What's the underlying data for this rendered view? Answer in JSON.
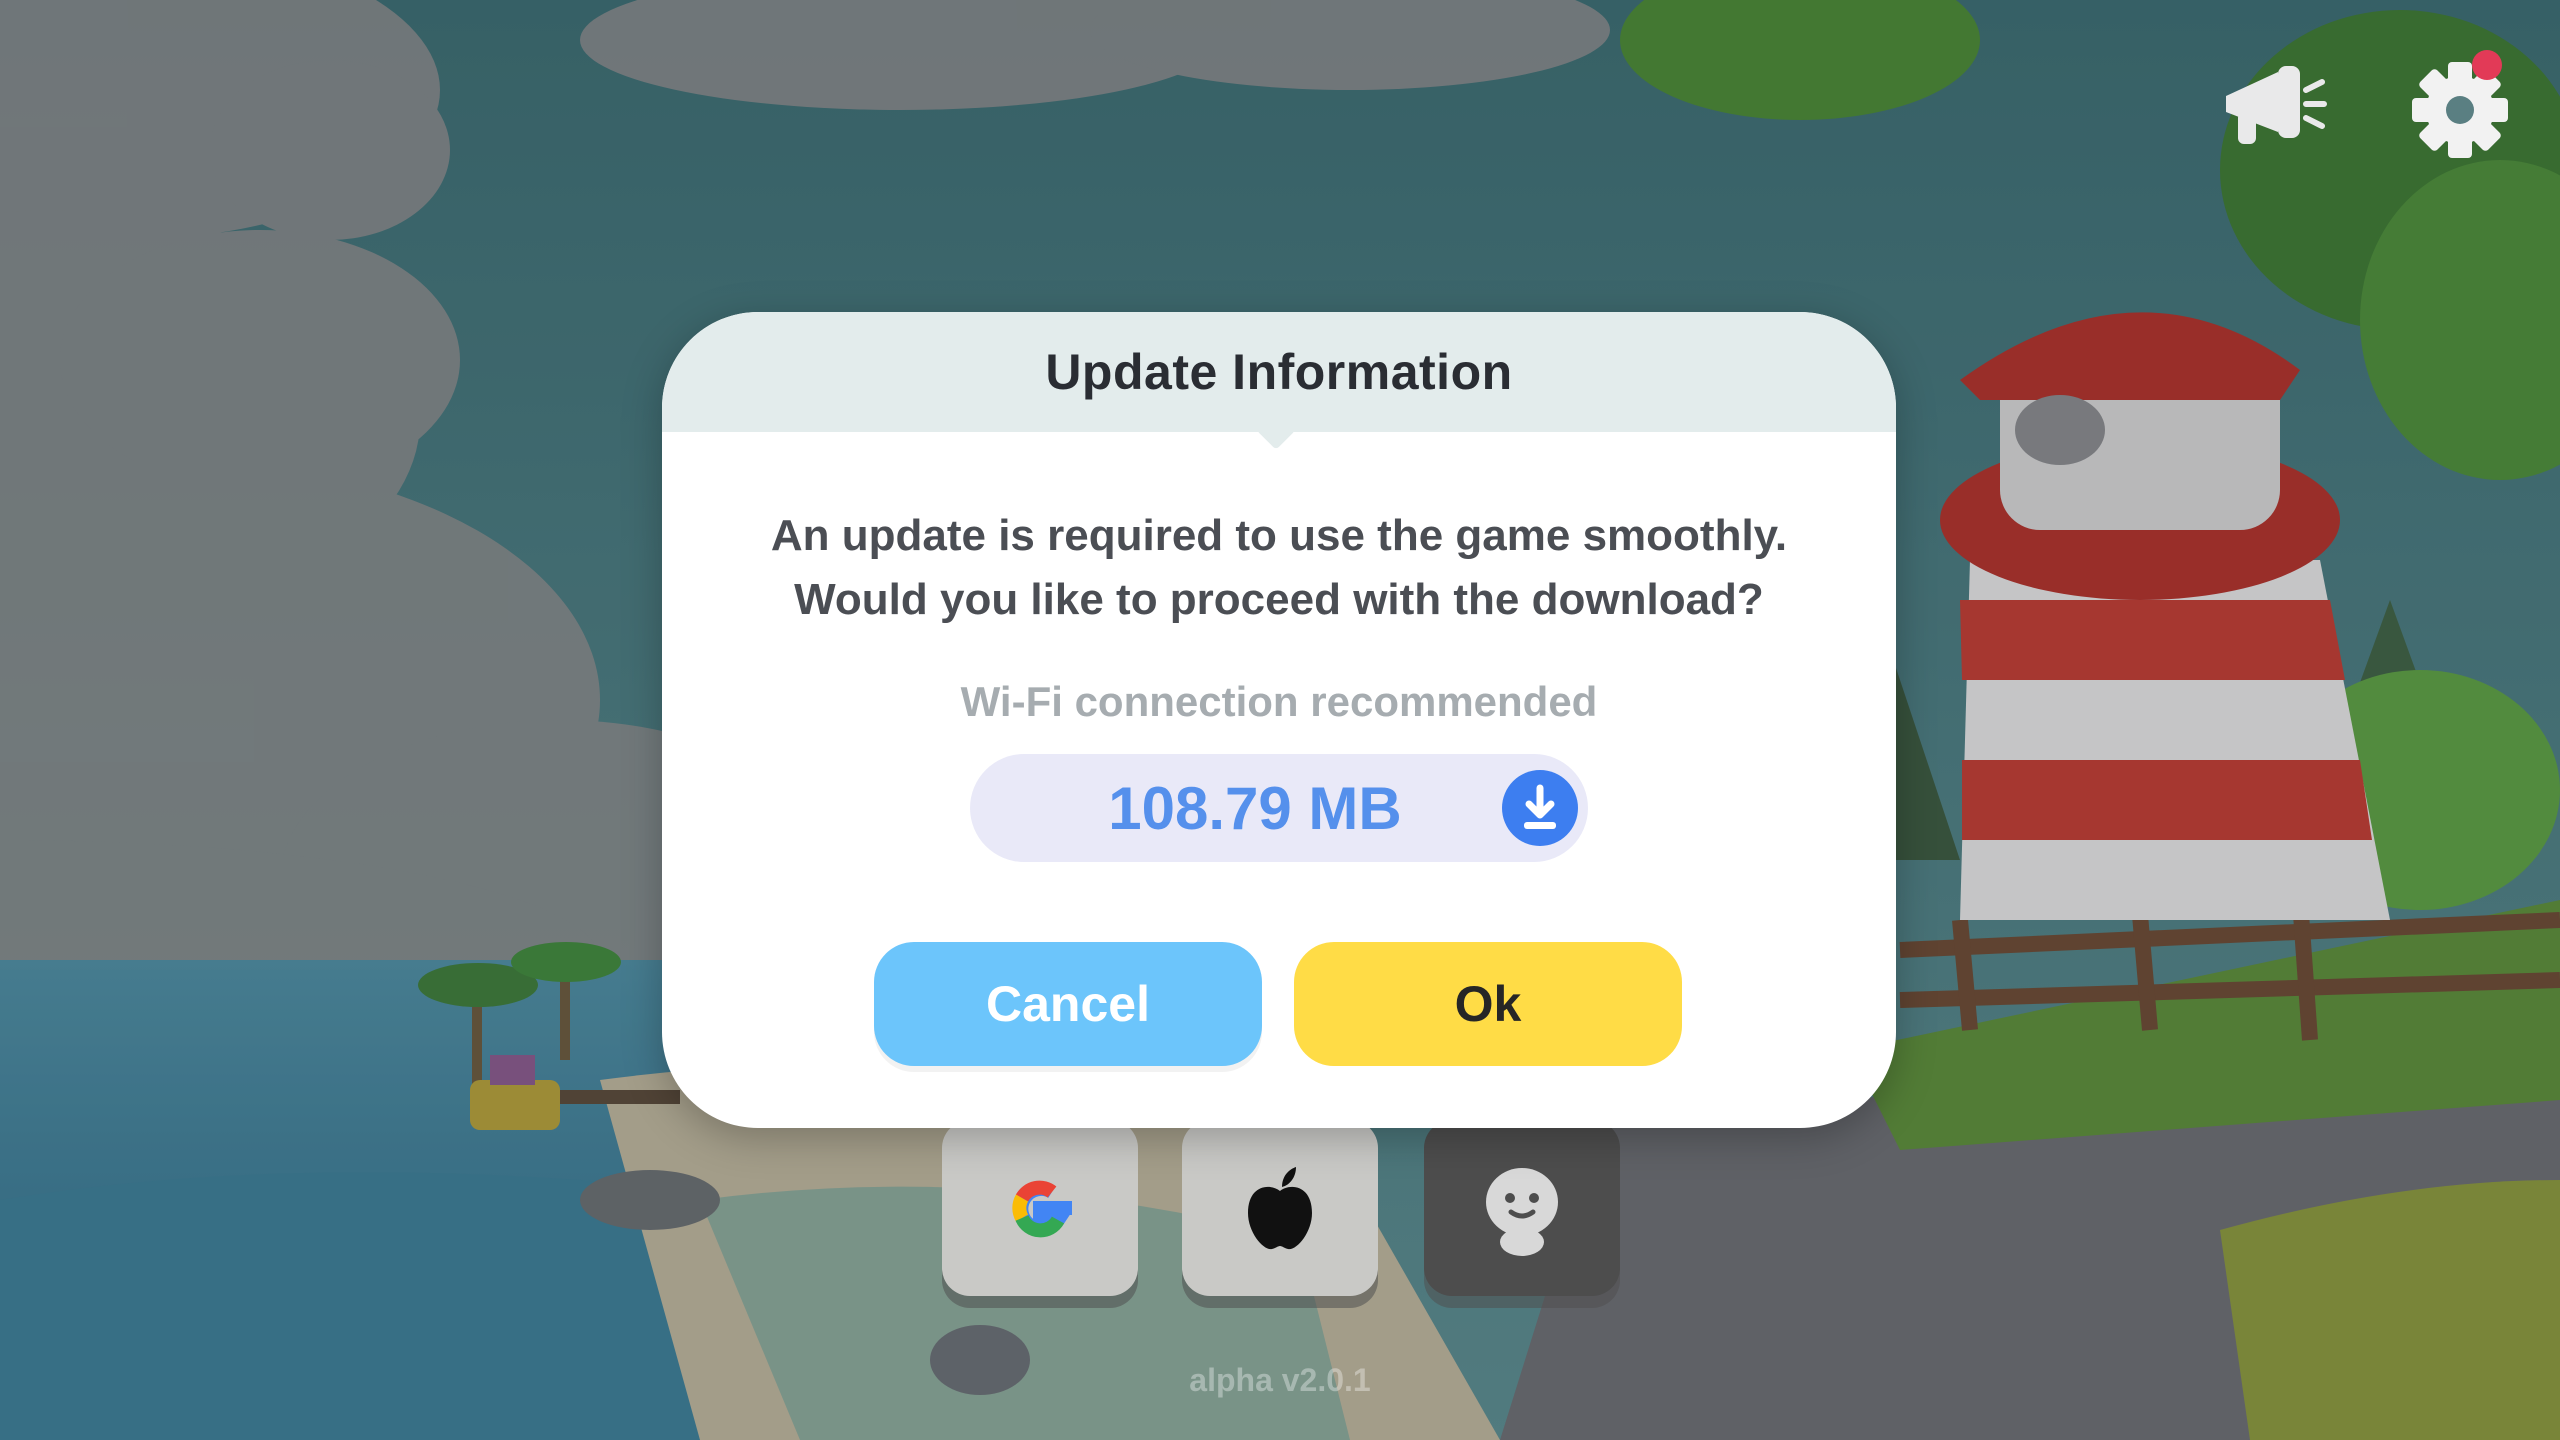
{
  "modal": {
    "title": "Update Information",
    "message_line1": "An update is required to use the game smoothly.",
    "message_line2": "Would you like to proceed with the download?",
    "wifi_note": "Wi-Fi connection recommended",
    "download_size": "108.79 MB",
    "cancel_label": "Cancel",
    "ok_label": "Ok"
  },
  "hud": {
    "icons": [
      "megaphone-icon",
      "gear-icon"
    ],
    "settings_notification": true
  },
  "login": {
    "buttons": [
      "google-logo",
      "apple-logo",
      "guest-icon"
    ]
  },
  "version": "alpha v2.0.1",
  "colors": {
    "header_bg": "#e3ecec",
    "cancel_bg": "#6cc5fb",
    "ok_bg": "#ffdc46",
    "size_text": "#5590ec",
    "download_icon_bg": "#3d7ef0",
    "notification_dot": "#e23a57"
  }
}
